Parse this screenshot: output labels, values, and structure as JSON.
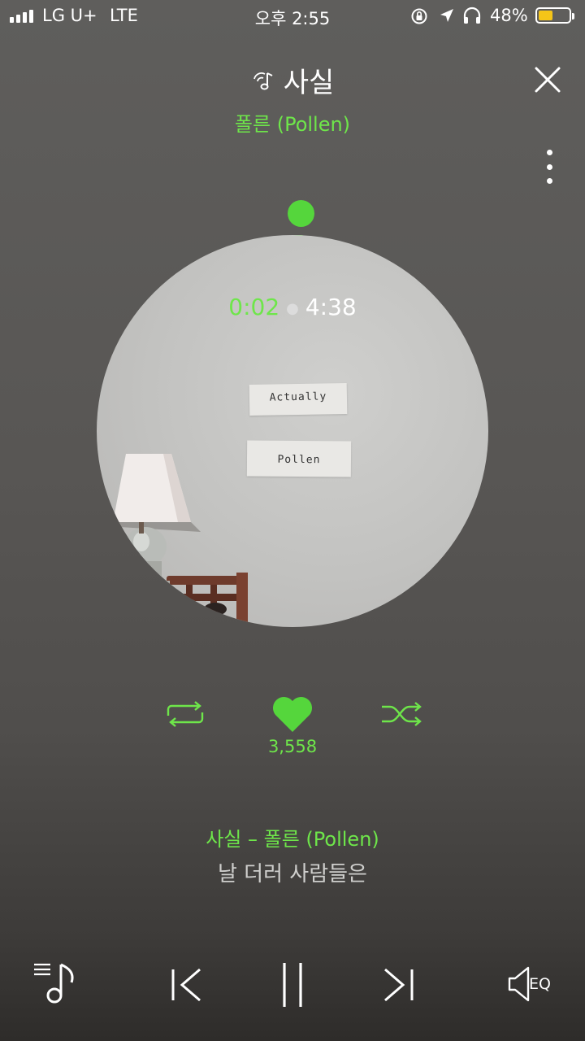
{
  "status_bar": {
    "carrier": "LG U+",
    "network": "LTE",
    "time": "오후 2:55",
    "battery_percent": "48%",
    "battery_level": 0.48,
    "battery_color": "#f5c518"
  },
  "header": {
    "song_title": "사실",
    "artist": "폴른 (Pollen)",
    "title_icon": "music-note-signal-icon",
    "close_icon": "close-icon",
    "more_icon": "more-vertical-icon"
  },
  "player": {
    "current_time": "0:02",
    "total_time": "4:38",
    "progress": 0.007,
    "album_text_1": "Actually",
    "album_text_2": "Pollen"
  },
  "actions": {
    "repeat_icon": "repeat-icon",
    "like_icon": "heart-icon",
    "like_count": "3,558",
    "shuffle_icon": "shuffle-icon"
  },
  "lyrics": {
    "title_line": "사실 – 폴른 (Pollen)",
    "current_line": "날 더러 사람들은"
  },
  "bottom_bar": {
    "playlist_icon": "playlist-icon",
    "prev_icon": "previous-icon",
    "pause_icon": "pause-icon",
    "next_icon": "next-icon",
    "eq_label": "EQ"
  },
  "colors": {
    "accent": "#6ee64a",
    "background": "#585654"
  }
}
